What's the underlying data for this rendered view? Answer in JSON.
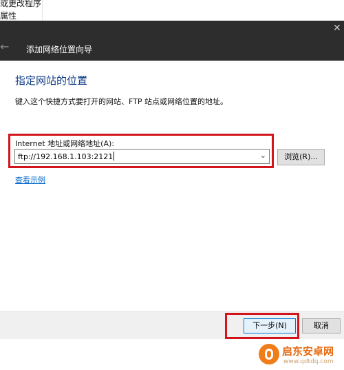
{
  "background": {
    "items": [
      "或更改程序",
      "属性"
    ]
  },
  "window": {
    "back_icon": "back-arrow-icon",
    "title": "添加网络位置向导",
    "close_icon": "close-icon"
  },
  "page": {
    "heading": "指定网站的位置",
    "instruction": "键入这个快捷方式要打开的网站、FTP 站点或网络位置的地址。",
    "address_label": "Internet 地址或网络地址(A):",
    "address_value": "ftp://192.168.1.103:2121",
    "browse_label": "浏览(R)...",
    "example_link": "查看示例"
  },
  "footer": {
    "next_label": "下一步(N)",
    "cancel_label": "取消"
  },
  "watermark": {
    "title": "启东安卓网",
    "url": "www.qdtdq.com"
  },
  "colors": {
    "titlebar": "#2d2d2d",
    "heading": "#0e3a85",
    "highlight": "#d3141b",
    "link": "#0066cc",
    "primary_button_border": "#0078d7"
  }
}
